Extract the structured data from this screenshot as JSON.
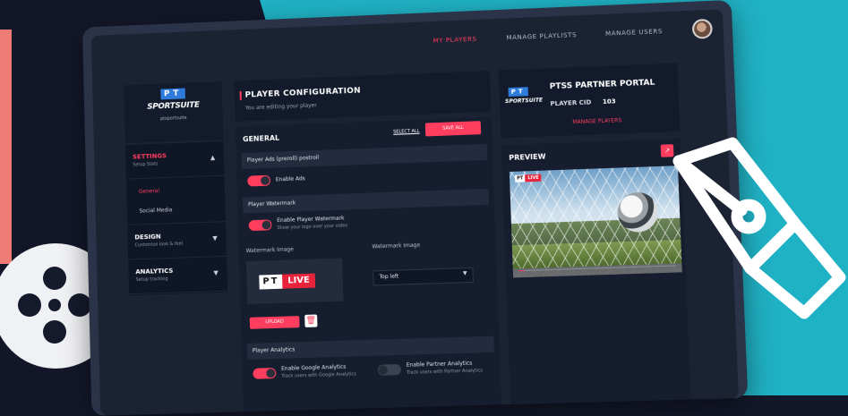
{
  "nav": {
    "items": [
      "MY PLAYERS",
      "MANAGE PLAYLISTS",
      "MANAGE USERS"
    ],
    "active_index": 0
  },
  "brand": {
    "logo_mark": "PT",
    "logo_name": "SPORTSUITE",
    "logo_sub": "ptsportsuite"
  },
  "sidebar": {
    "items": [
      {
        "title": "SETTINGS",
        "sub": "Setup Stats"
      },
      {
        "title": "DESIGN",
        "sub": "Customise look & feel"
      },
      {
        "title": "ANALYTICS",
        "sub": "Setup tracking"
      }
    ],
    "settings_subitems": [
      "General",
      "Social Media"
    ]
  },
  "config": {
    "title": "PLAYER CONFIGURATION",
    "subtitle": "You are editing your player"
  },
  "general": {
    "title": "GENERAL",
    "select_all": "SELECT ALL",
    "save_all": "SAVE ALL",
    "sections": {
      "ads": "Player Ads (preroll) postroll",
      "watermark": "Player Watermark",
      "analytics": "Player Analytics"
    },
    "toggles": {
      "enable_ads": {
        "label": "Enable Ads",
        "on": true
      },
      "enable_watermark": {
        "label": "Enable Player Watermark",
        "sub": "Show your logo over your video",
        "on": true
      },
      "google_analytics": {
        "label": "Enable Google Analytics",
        "sub": "Track users with Google Analytics",
        "on": true
      },
      "partner_analytics": {
        "label": "Enable Partner Analytics",
        "sub": "Track users with Partner Analytics",
        "on": false
      }
    },
    "watermark_image_label": "Watermark Image",
    "watermark_position_label": "Watermark Image",
    "watermark_position_value": "Top left",
    "upload_label": "UPLOAD",
    "watermark_preview": {
      "pt": "PT",
      "live": "LIVE"
    }
  },
  "partner": {
    "title": "PTSS PARTNER PORTAL",
    "cid_label": "PLAYER CID",
    "cid_value": "103",
    "link": "MANAGE PLAYERS",
    "logo_mark": "PT",
    "logo_name": "SPORTSUITE"
  },
  "preview": {
    "title": "PREVIEW",
    "badge_pt": "PT",
    "badge_live": "LIVE",
    "progress": 0.04
  },
  "colors": {
    "accent": "#ff3d5e",
    "teal": "#1fb1c4",
    "coral": "#f07a74",
    "panel": "#121a2b"
  }
}
